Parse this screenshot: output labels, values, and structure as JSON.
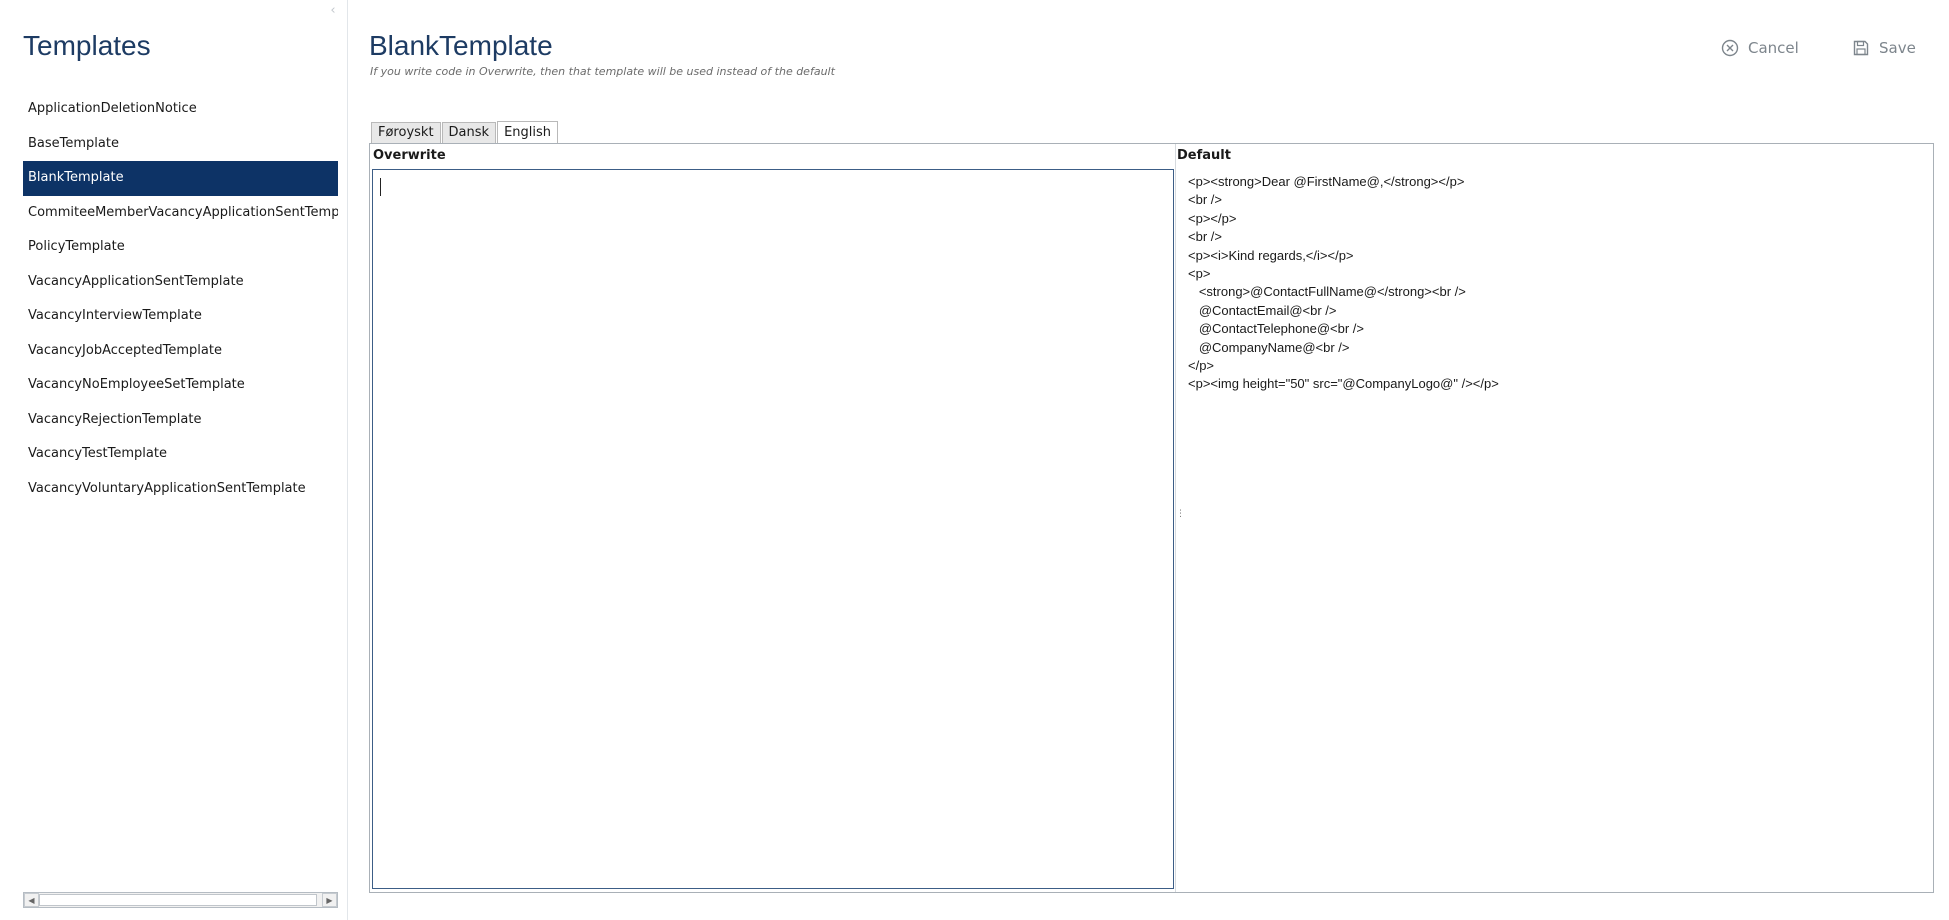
{
  "sidebar": {
    "title": "Templates",
    "collapse_glyph": "‹",
    "items": [
      {
        "label": "ApplicationDeletionNotice",
        "selected": false
      },
      {
        "label": "BaseTemplate",
        "selected": false
      },
      {
        "label": "BlankTemplate",
        "selected": true
      },
      {
        "label": "CommiteeMemberVacancyApplicationSentTemplate",
        "selected": false
      },
      {
        "label": "PolicyTemplate",
        "selected": false
      },
      {
        "label": "VacancyApplicationSentTemplate",
        "selected": false
      },
      {
        "label": "VacancyInterviewTemplate",
        "selected": false
      },
      {
        "label": "VacancyJobAcceptedTemplate",
        "selected": false
      },
      {
        "label": "VacancyNoEmployeeSetTemplate",
        "selected": false
      },
      {
        "label": "VacancyRejectionTemplate",
        "selected": false
      },
      {
        "label": "VacancyTestTemplate",
        "selected": false
      },
      {
        "label": "VacancyVoluntaryApplicationSentTemplate",
        "selected": false
      }
    ],
    "scroll_left_glyph": "◀",
    "scroll_right_glyph": "▶"
  },
  "header": {
    "title": "BlankTemplate",
    "subtitle": "If you write code in Overwrite, then that template will be used instead of the default",
    "cancel_label": "Cancel",
    "save_label": "Save"
  },
  "tabs": [
    {
      "label": "Føroyskt",
      "active": false
    },
    {
      "label": "Dansk",
      "active": false
    },
    {
      "label": "English",
      "active": true
    }
  ],
  "editor": {
    "overwrite_label": "Overwrite",
    "overwrite_value": "",
    "default_label": "Default",
    "default_code": "<p><strong>Dear @FirstName@,</strong></p>\n<br />\n<p></p>\n<br />\n<p><i>Kind regards,</i></p>\n<p>\n   <strong>@ContactFullName@</strong><br />\n   @ContactEmail@<br />\n   @ContactTelephone@<br />\n   @CompanyName@<br />\n</p>\n<p><img height=\"50\" src=\"@CompanyLogo@\" /></p>"
  },
  "colors": {
    "accent": "#1d3b63",
    "selected_bg": "#0d3366",
    "muted": "#7d858c"
  },
  "icons": {
    "cancel": "close-circle-icon",
    "save": "floppy-disk-icon"
  }
}
